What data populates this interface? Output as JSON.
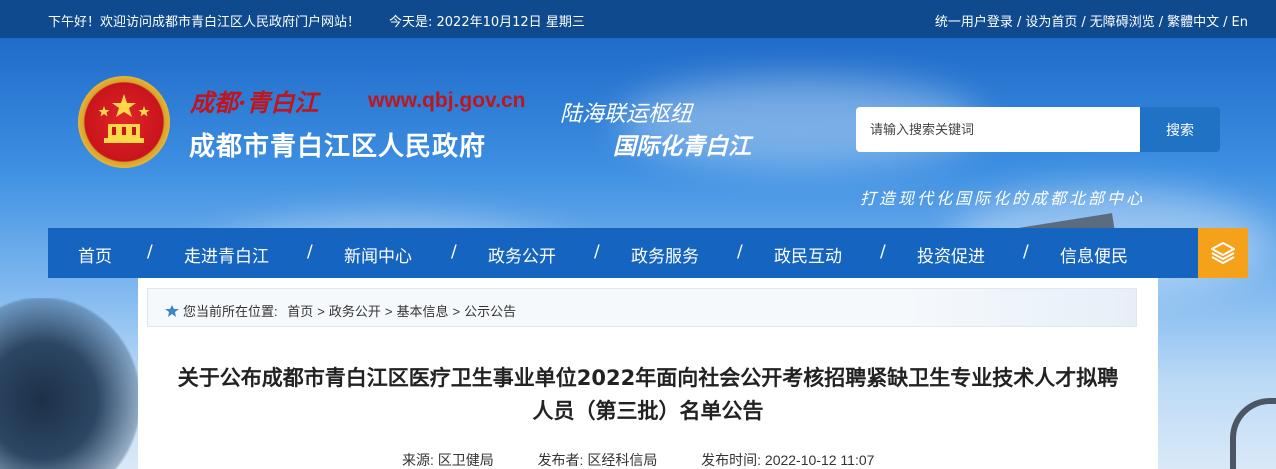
{
  "topbar": {
    "greeting": "下午好！欢迎访问成都市青白江区人民政府门户网站！",
    "date": "今天是: 2022年10月12日 星期三",
    "links": [
      "统一用户登录",
      "设为首页",
      "无障碍浏览",
      "繁體中文",
      "En"
    ],
    "separator": "/"
  },
  "header": {
    "logo_script": "成都·青白江",
    "logo_url": "www.qbj.gov.cn",
    "gov_name": "成都市青白江区人民政府",
    "slogan_line1": "陆海联运枢纽",
    "slogan_line2": "国际化青白江",
    "tagline": "打造现代化国际化的成都北部中心"
  },
  "search": {
    "placeholder": "请输入搜索关键词",
    "button_label": "搜索"
  },
  "nav": {
    "items": [
      "首页",
      "走进青白江",
      "新闻中心",
      "政务公开",
      "政务服务",
      "政民互动",
      "投资促进",
      "信息便民"
    ],
    "separator": "/"
  },
  "breadcrumb": {
    "prefix": "您当前所在位置:",
    "items": [
      "首页",
      "政务公开",
      "基本信息",
      "公示公告"
    ],
    "arrow": ">"
  },
  "article": {
    "title_line1": "关于公布成都市青白江区医疗卫生事业单位2022年面向社会公开考核招聘紧缺卫生专业技术人才拟聘",
    "title_line2": "人员（第三批）名单公告",
    "source_label": "来源:",
    "source": "区卫健局",
    "publisher_label": "发布者:",
    "publisher": "区经科信局",
    "time_label": "发布时间:",
    "time": "2022-10-12 11:07"
  },
  "colors": {
    "topbar": "#0f4a8f",
    "nav": "#1565c0",
    "nav_menu": "#f5a21a",
    "search_button": "#1f72c4",
    "logo_red": "#c0151c"
  },
  "icons": {
    "nav_menu": "layers-icon",
    "breadcrumb": "location-icon",
    "emblem": "national-emblem-icon"
  }
}
